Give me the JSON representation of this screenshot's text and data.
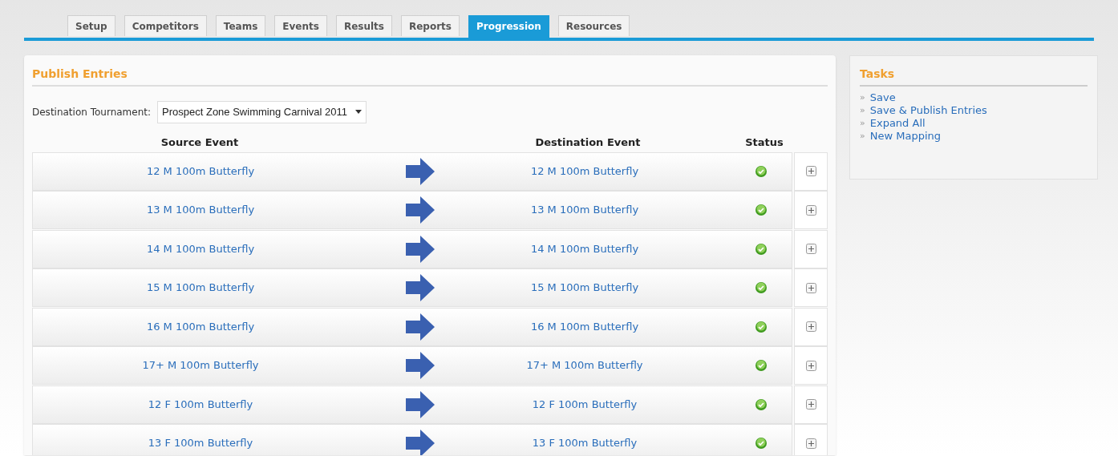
{
  "tabs": [
    {
      "label": "Setup",
      "selected": false
    },
    {
      "label": "Competitors",
      "selected": false
    },
    {
      "label": "Teams",
      "selected": false
    },
    {
      "label": "Events",
      "selected": false
    },
    {
      "label": "Results",
      "selected": false
    },
    {
      "label": "Reports",
      "selected": false
    },
    {
      "label": "Progression",
      "selected": true
    },
    {
      "label": "Resources",
      "selected": false
    }
  ],
  "panel": {
    "title": "Publish Entries",
    "tournament_label": "Destination Tournament:",
    "tournament_value": "Prospect Zone Swimming Carnival 2011"
  },
  "table": {
    "columns": [
      "Source Event",
      "Destination Event",
      "Status"
    ],
    "rows": [
      {
        "source": "12 M 100m Butterfly",
        "destination": "12 M 100m Butterfly",
        "status_ok": true,
        "expanded": false
      },
      {
        "source": "13 M 100m Butterfly",
        "destination": "13 M 100m Butterfly",
        "status_ok": true,
        "expanded": false
      },
      {
        "source": "14 M 100m Butterfly",
        "destination": "14 M 100m Butterfly",
        "status_ok": true,
        "expanded": false
      },
      {
        "source": "15 M 100m Butterfly",
        "destination": "15 M 100m Butterfly",
        "status_ok": true,
        "expanded": false
      },
      {
        "source": "16 M 100m Butterfly",
        "destination": "16 M 100m Butterfly",
        "status_ok": true,
        "expanded": false
      },
      {
        "source": "17+ M 100m Butterfly",
        "destination": "17+ M 100m Butterfly",
        "status_ok": true,
        "expanded": false
      },
      {
        "source": "12 F 100m Butterfly",
        "destination": "12 F 100m Butterfly",
        "status_ok": true,
        "expanded": false
      },
      {
        "source": "13 F 100m Butterfly",
        "destination": "13 F 100m Butterfly",
        "status_ok": true,
        "expanded": false
      }
    ]
  },
  "tasks": {
    "title": "Tasks",
    "items": [
      {
        "bullet": "»",
        "label": "Save"
      },
      {
        "bullet": "»",
        "label": "Save & Publish Entries"
      },
      {
        "bullet": "»",
        "label": "Expand All"
      },
      {
        "bullet": "»",
        "label": "New Mapping"
      }
    ]
  }
}
